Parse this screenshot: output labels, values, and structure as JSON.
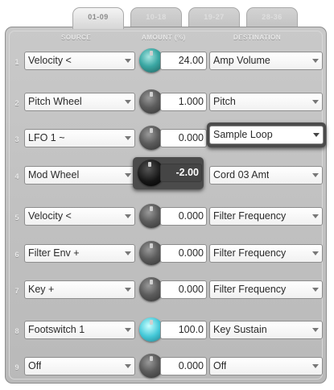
{
  "tabs": [
    "01-09",
    "10-18",
    "19-27",
    "28-36"
  ],
  "active_tab_index": 0,
  "headers": {
    "source": "SOURCE",
    "amount": "AMOUNT (%)",
    "destination": "DESTINATION"
  },
  "cords": [
    {
      "num": "1",
      "source": "Velocity <",
      "amount": "24.00",
      "destination": "Amp Volume",
      "knob": "teal"
    },
    {
      "num": "2",
      "source": "Pitch Wheel",
      "amount": "1.000",
      "destination": "Pitch",
      "knob": "gray"
    },
    {
      "num": "3",
      "source": "LFO 1 ~",
      "amount": "0.000",
      "destination": "Sample Loop",
      "knob": "gray",
      "destination_highlighted": true
    },
    {
      "num": "4",
      "source": "Mod Wheel",
      "amount": "-2.00",
      "destination": "Cord 03 Amt",
      "knob": "black",
      "amount_highlighted": true
    },
    {
      "num": "5",
      "source": "Velocity <",
      "amount": "0.000",
      "destination": "Filter Frequency",
      "knob": "gray"
    },
    {
      "num": "6",
      "source": "Filter Env +",
      "amount": "0.000",
      "destination": "Filter Frequency",
      "knob": "gray"
    },
    {
      "num": "7",
      "source": "Key +",
      "amount": "0.000",
      "destination": "Filter Frequency",
      "knob": "gray"
    },
    {
      "num": "8",
      "source": "Footswitch 1",
      "amount": "100.0",
      "destination": "Key Sustain",
      "knob": "cyan"
    },
    {
      "num": "9",
      "source": "Off",
      "amount": "0.000",
      "destination": "Off",
      "knob": "gray"
    }
  ]
}
